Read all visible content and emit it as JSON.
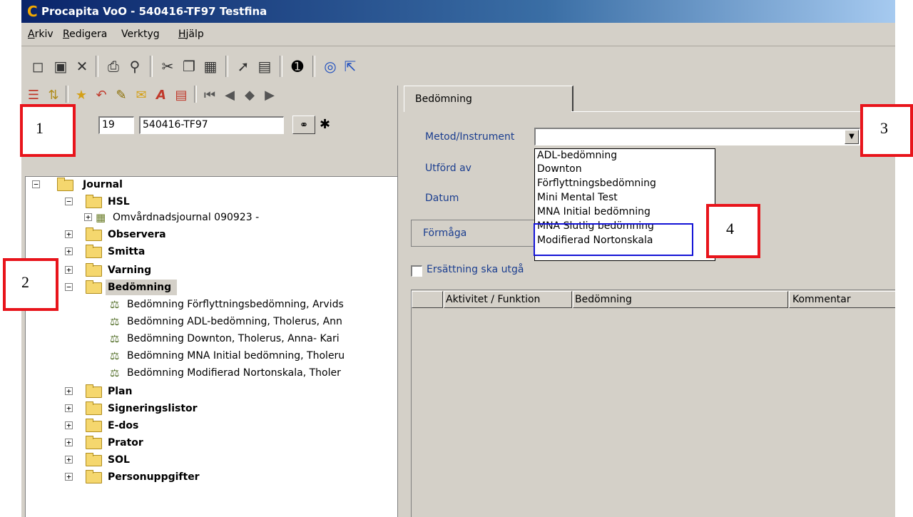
{
  "window": {
    "title": "Procapita VoO - 540416-TF97 Testfina",
    "app_icon": "procapita-c-logo"
  },
  "menu": {
    "items": [
      {
        "label": "Arkiv",
        "mnemonic": "A"
      },
      {
        "label": "Redigera",
        "mnemonic": "R"
      },
      {
        "label": "Verktyg",
        "mnemonic": ""
      },
      {
        "label": "Hjälp",
        "mnemonic": "H"
      }
    ]
  },
  "toolbar": {
    "icons": [
      "new-document-icon",
      "save-icon",
      "delete-icon",
      "print-icon",
      "find-icon",
      "cut-icon",
      "copy-icon",
      "paste-icon",
      "pin-icon",
      "form-icon",
      "info-icon",
      "help-icon",
      "context-help-icon"
    ]
  },
  "patient": {
    "number": "19",
    "id": "540416-TF97"
  },
  "tree": {
    "root": "Journal",
    "nodes": [
      {
        "label": "HSL",
        "expanded": true
      },
      {
        "label": "Omvårdnadsjournal 090923 -",
        "child": true
      },
      {
        "label": "Observera"
      },
      {
        "label": "Smitta"
      },
      {
        "label": "Varning"
      },
      {
        "label": "Bedömning",
        "expanded": true,
        "selected": true
      },
      {
        "label": "Bedömning Förflyttningsbedömning, Arvids",
        "leaf": true
      },
      {
        "label": "Bedömning ADL-bedömning, Tholerus, Ann",
        "leaf": true
      },
      {
        "label": "Bedömning Downton, Tholerus, Anna- Kari",
        "leaf": true
      },
      {
        "label": "Bedömning MNA Initial bedömning, Tholeru",
        "leaf": true
      },
      {
        "label": "Bedömning Modifierad Nortonskala, Tholer",
        "leaf": true
      },
      {
        "label": "Plan"
      },
      {
        "label": "Signeringslistor"
      },
      {
        "label": "E-dos"
      },
      {
        "label": "Prator"
      },
      {
        "label": "SOL"
      },
      {
        "label": "Personuppgifter"
      }
    ]
  },
  "form": {
    "tab_label": "Bedömning",
    "metod_label": "Metod/Instrument",
    "metod_value": "",
    "utford_label": "Utförd av",
    "datum_label": "Datum",
    "dropdown_options": [
      "ADL-bedömning",
      "Downton",
      "Förflyttningsbedömning",
      "Mini Mental Test",
      "MNA Initial bedömning",
      "MNA Slutlig bedömning",
      "Modifierad Nortonskala"
    ],
    "formaga_label": "Förmåga",
    "checkbox_label": "Ersättning ska utgå",
    "checkbox_checked": false,
    "grid_columns": [
      "Aktivitet / Funktion",
      "Bedömning",
      "Kommentar"
    ]
  },
  "annotations": {
    "box1": "1",
    "box2": "2",
    "box3": "3",
    "box4": "4",
    "red_color": "#e8141b",
    "blue_color": "#1414d6"
  }
}
